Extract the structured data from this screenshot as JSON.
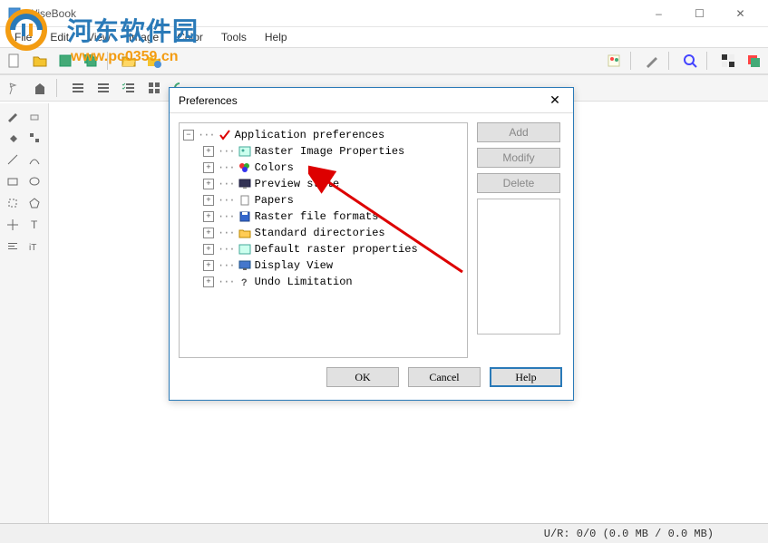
{
  "window": {
    "title": "WiseBook",
    "controls": {
      "min": "–",
      "max": "☐",
      "close": "✕"
    }
  },
  "menu": [
    "File",
    "Edit",
    "View",
    "Image",
    "Color",
    "Tools",
    "Help"
  ],
  "watermark": {
    "line1": "河东软件园",
    "line2": "www.pc0359.cn"
  },
  "statusbar": {
    "text": "U/R: 0/0 (0.0 MB / 0.0 MB)"
  },
  "dialog": {
    "title": "Preferences",
    "close": "✕",
    "side_buttons": {
      "add": "Add",
      "modify": "Modify",
      "delete": "Delete"
    },
    "footer": {
      "ok": "OK",
      "cancel": "Cancel",
      "help": "Help"
    },
    "tree": {
      "root": "Application preferences",
      "items": [
        "Raster Image Properties",
        "Colors",
        "Preview style",
        "Papers",
        "Raster file formats",
        "Standard directories",
        "Default raster properties",
        "Display View",
        "Undo Limitation"
      ]
    }
  }
}
